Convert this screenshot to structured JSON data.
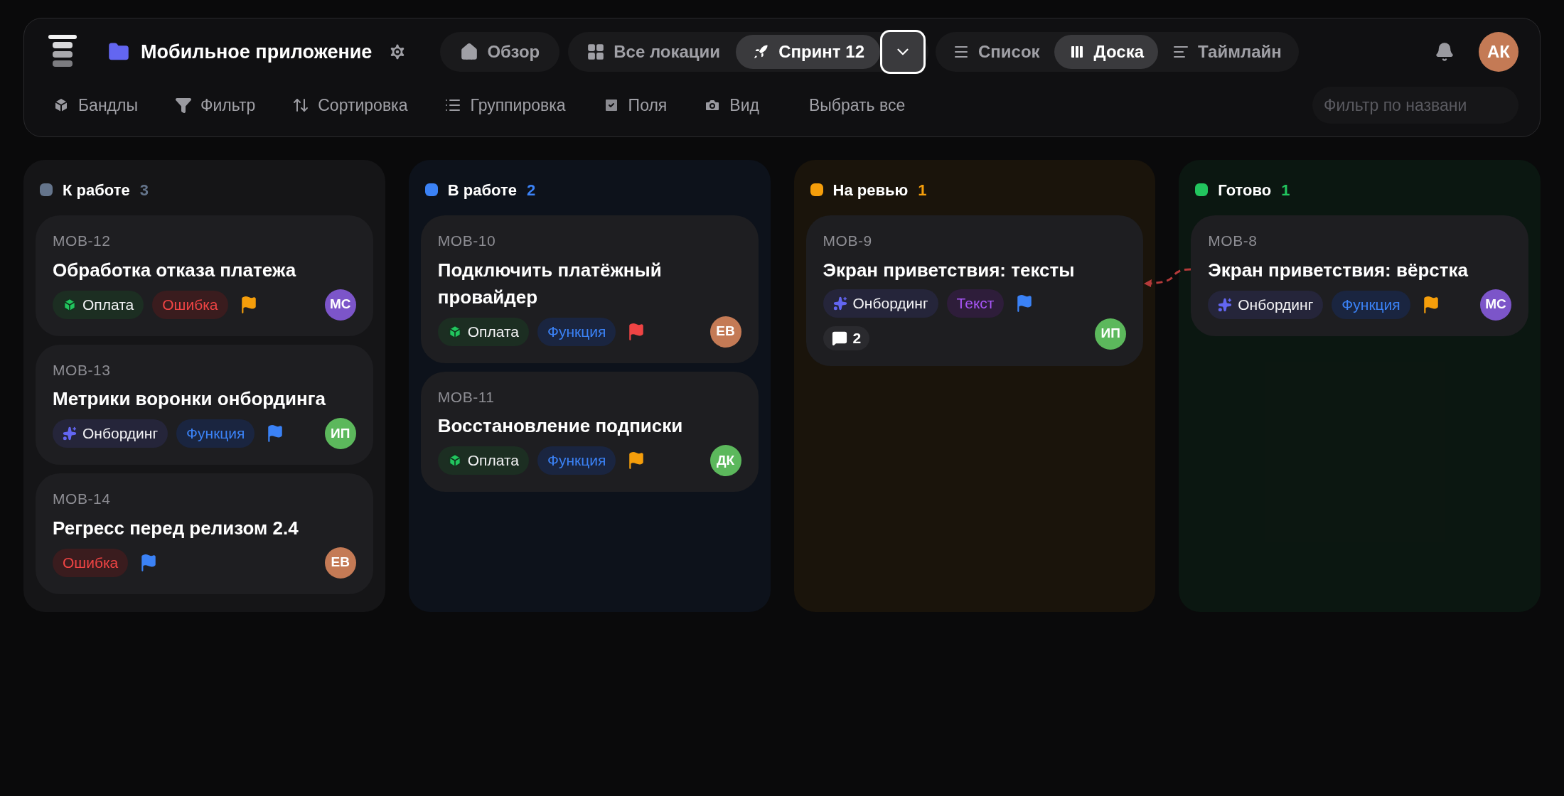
{
  "header": {
    "project_title": "Мобильное приложение",
    "overview": {
      "label": "Обзор",
      "selected": false
    },
    "locations": [
      {
        "label": "Все локации",
        "selected": false
      },
      {
        "label": "Спринт 12",
        "selected": true
      }
    ],
    "location_dropdown": {
      "focused": true
    },
    "views": [
      {
        "label": "Список",
        "selected": false
      },
      {
        "label": "Доска",
        "selected": true
      },
      {
        "label": "Таймлайн",
        "selected": false
      }
    ],
    "user_avatar": {
      "initials": "АК",
      "color": "#c47a55"
    },
    "toolbar": [
      {
        "label": "Бандлы",
        "kind": "cube"
      },
      {
        "label": "Фильтр",
        "kind": "funnel"
      },
      {
        "label": "Сортировка",
        "kind": "sort"
      },
      {
        "label": "Группировка",
        "kind": "list"
      },
      {
        "label": "Поля",
        "kind": "checkbox"
      },
      {
        "label": "Вид",
        "kind": "camera"
      },
      {
        "label": "Выбрать все",
        "kind": "plain"
      }
    ],
    "search": {
      "placeholder": "Фильтр по названи"
    }
  },
  "columns": [
    {
      "title": "К работе",
      "count": "3",
      "color": "#64748b",
      "cards": [
        {
          "id": "MOB-12",
          "title": "Обработка отказа платежа",
          "tags": [
            {
              "label": "Оплата",
              "kind": "cube"
            },
            {
              "label": "Ошибка",
              "kind": "error"
            }
          ],
          "flag": {
            "color": "#f59e0b"
          },
          "assignee": {
            "initials": "МС",
            "color": "#7c55c9"
          }
        },
        {
          "id": "MOB-13",
          "title": "Метрики воронки онбординга",
          "tags": [
            {
              "label": "Онбординг",
              "kind": "sparkle"
            },
            {
              "label": "Функция",
              "kind": "feature"
            }
          ],
          "flag": {
            "color": "#3b82f6"
          },
          "assignee": {
            "initials": "ИП",
            "color": "#5cb85c"
          }
        },
        {
          "id": "MOB-14",
          "title": "Регресс перед релизом 2.4",
          "tags": [
            {
              "label": "Ошибка",
              "kind": "error"
            }
          ],
          "flag": {
            "color": "#3b82f6"
          },
          "assignee": {
            "initials": "ЕВ",
            "color": "#c47a55"
          }
        }
      ]
    },
    {
      "title": "В работе",
      "count": "2",
      "color": "#3b82f6",
      "cards": [
        {
          "id": "MOB-10",
          "title": "Подключить платёжный провайдер",
          "tags": [
            {
              "label": "Оплата",
              "kind": "cube"
            },
            {
              "label": "Функция",
              "kind": "feature"
            }
          ],
          "flag": {
            "color": "#ef4444"
          },
          "assignee": {
            "initials": "ЕВ",
            "color": "#c47a55"
          }
        },
        {
          "id": "MOB-11",
          "title": "Восстановление подписки",
          "tags": [
            {
              "label": "Оплата",
              "kind": "cube"
            },
            {
              "label": "Функция",
              "kind": "feature"
            }
          ],
          "flag": {
            "color": "#f59e0b"
          },
          "assignee": {
            "initials": "ДК",
            "color": "#5cb85c"
          }
        }
      ]
    },
    {
      "title": "На ревью",
      "count": "1",
      "color": "#f59e0b",
      "cards": [
        {
          "id": "MOB-9",
          "title": "Экран приветствия: тексты",
          "tags": [
            {
              "label": "Онбординг",
              "kind": "sparkle"
            },
            {
              "label": "Текст",
              "kind": "text"
            }
          ],
          "flag": {
            "color": "#3b82f6"
          },
          "comments": "2",
          "assignee": {
            "initials": "ИП",
            "color": "#5cb85c"
          }
        }
      ]
    },
    {
      "title": "Готово",
      "count": "1",
      "color": "#22c55e",
      "cards": [
        {
          "id": "MOB-8",
          "title": "Экран приветствия: вёрстка",
          "tags": [
            {
              "label": "Онбординг",
              "kind": "sparkle"
            },
            {
              "label": "Функция",
              "kind": "feature"
            }
          ],
          "flag": {
            "color": "#f59e0b"
          },
          "assignee": {
            "initials": "МС",
            "color": "#7c55c9"
          }
        }
      ]
    }
  ]
}
